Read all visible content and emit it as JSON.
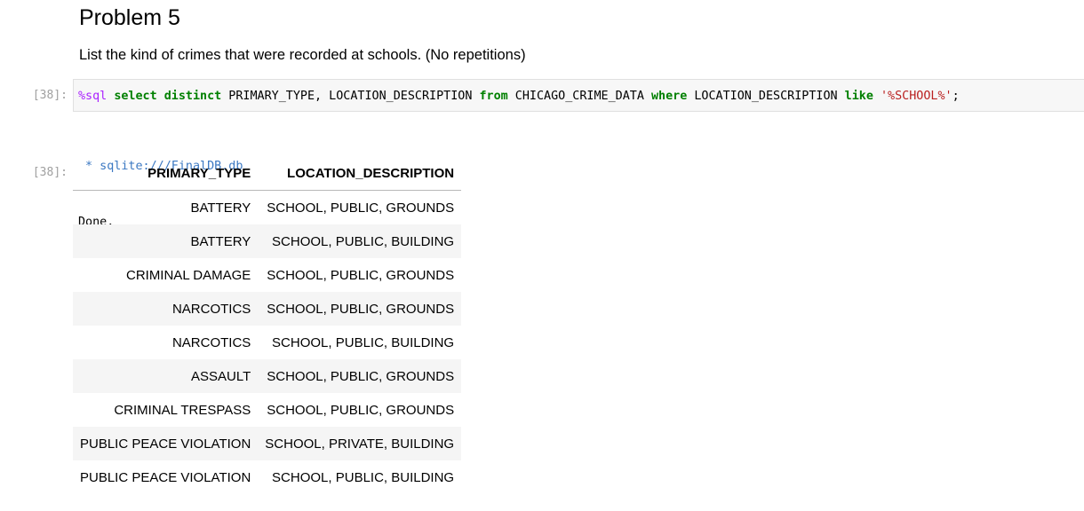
{
  "markdown": {
    "title": "Problem 5",
    "text": "List the kind of crimes that were recorded at schools. (No repetitions)"
  },
  "code_cell": {
    "prompt": "[38]:",
    "magic": "%sql",
    "tokens": [
      {
        "t": " ",
        "k": "plain"
      },
      {
        "t": "select",
        "k": "kw"
      },
      {
        "t": " ",
        "k": "plain"
      },
      {
        "t": "distinct",
        "k": "kw"
      },
      {
        "t": " PRIMARY_TYPE, LOCATION_DESCRIPTION ",
        "k": "plain"
      },
      {
        "t": "from",
        "k": "kw"
      },
      {
        "t": " CHICAGO_CRIME_DATA ",
        "k": "plain"
      },
      {
        "t": "where",
        "k": "kw"
      },
      {
        "t": " LOCATION_DESCRIPTION ",
        "k": "plain"
      },
      {
        "t": "like",
        "k": "kw"
      },
      {
        "t": " ",
        "k": "plain"
      },
      {
        "t": "'%SCHOOL%'",
        "k": "str"
      },
      {
        "t": ";",
        "k": "plain"
      }
    ]
  },
  "output": {
    "stdout_connection": " * sqlite:///FinalDB.db",
    "stdout_status": "Done.",
    "prompt": "[38]:",
    "table": {
      "headers": [
        "PRIMARY_TYPE",
        "LOCATION_DESCRIPTION"
      ],
      "rows": [
        [
          "BATTERY",
          "SCHOOL, PUBLIC, GROUNDS"
        ],
        [
          "BATTERY",
          "SCHOOL, PUBLIC, BUILDING"
        ],
        [
          "CRIMINAL DAMAGE",
          "SCHOOL, PUBLIC, GROUNDS"
        ],
        [
          "NARCOTICS",
          "SCHOOL, PUBLIC, GROUNDS"
        ],
        [
          "NARCOTICS",
          "SCHOOL, PUBLIC, BUILDING"
        ],
        [
          "ASSAULT",
          "SCHOOL, PUBLIC, GROUNDS"
        ],
        [
          "CRIMINAL TRESPASS",
          "SCHOOL, PUBLIC, GROUNDS"
        ],
        [
          "PUBLIC PEACE VIOLATION",
          "SCHOOL, PRIVATE, BUILDING"
        ],
        [
          "PUBLIC PEACE VIOLATION",
          "SCHOOL, PUBLIC, BUILDING"
        ]
      ]
    }
  },
  "colors": {
    "magic": "#aa22ff",
    "keyword": "#008000",
    "string": "#ba2121",
    "prompt": "#a0a0a0",
    "connection": "#3b78c2",
    "code_bg": "#f7f7f7",
    "row_alt_bg": "#f5f5f5"
  }
}
